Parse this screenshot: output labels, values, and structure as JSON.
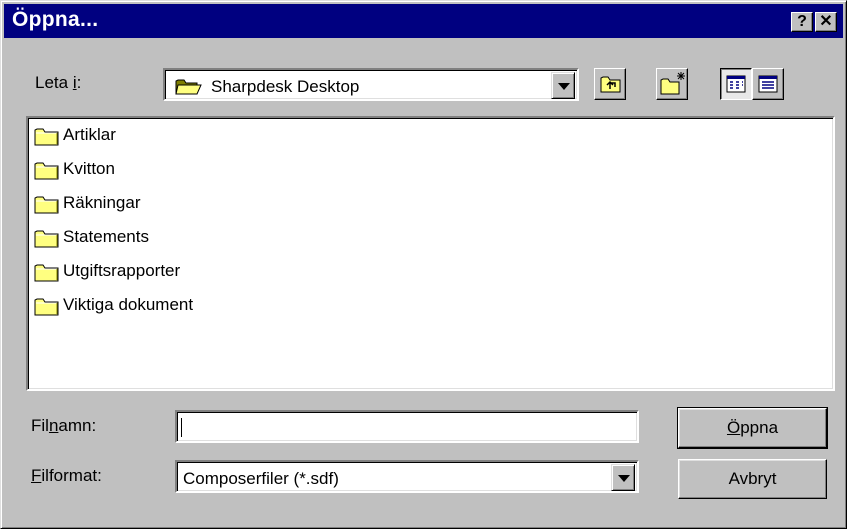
{
  "window": {
    "title": "Öppna..."
  },
  "titlebar_buttons": {
    "help": "?",
    "close": "✕"
  },
  "look_in": {
    "label": "Leta i:",
    "label_accesskey_prefix": "Leta ",
    "label_accesskey": "i",
    "label_suffix": ":",
    "value": "Sharpdesk Desktop",
    "icon": "folder-open-icon"
  },
  "toolbar": {
    "up_one_level": "up-folder-icon",
    "new_folder": "new-folder-icon",
    "list_view": "list-view-icon",
    "details_view": "details-view-icon"
  },
  "files": [
    {
      "name": "Artiklar",
      "icon": "folder-icon"
    },
    {
      "name": "Kvitton",
      "icon": "folder-icon"
    },
    {
      "name": "Räkningar",
      "icon": "folder-icon"
    },
    {
      "name": "Statements",
      "icon": "folder-icon"
    },
    {
      "name": "Utgiftsrapporter",
      "icon": "folder-icon"
    },
    {
      "name": "Viktiga dokument",
      "icon": "folder-icon"
    }
  ],
  "filename": {
    "label_pre": "Fil",
    "label_key": "n",
    "label_post": "amn:",
    "value": ""
  },
  "filetype": {
    "label_key": "F",
    "label_post": "ilformat:",
    "value": "Composerfiler (*.sdf)"
  },
  "buttons": {
    "open_key": "Ö",
    "open_rest": "ppna",
    "cancel": "Avbryt"
  },
  "colors": {
    "titlebar": "#000080",
    "face": "#c0c0c0",
    "folder": "#ffff80"
  }
}
